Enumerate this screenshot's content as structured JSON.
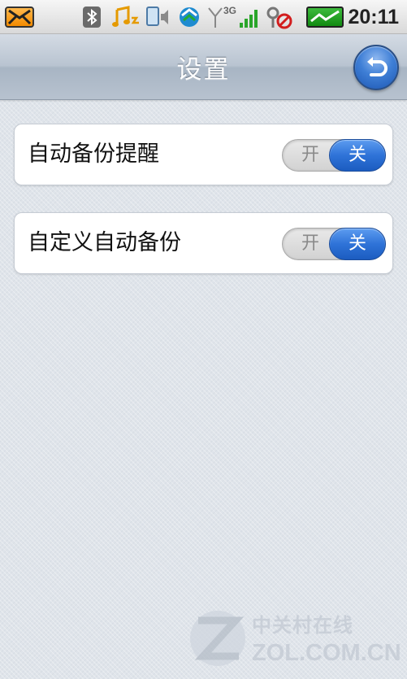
{
  "status_bar": {
    "time": "20:11",
    "signal_network_label": "3G",
    "icons": [
      "mail-icon",
      "bluetooth-icon",
      "music-icon",
      "volume-icon",
      "sync-icon",
      "signal-icon",
      "alarm-icon",
      "battery-icon"
    ]
  },
  "header": {
    "title": "设置",
    "back_icon": "back-arrow-icon"
  },
  "settings": [
    {
      "label": "自动备份提醒",
      "on_label": "开",
      "off_label": "关",
      "state": "off"
    },
    {
      "label": "自定义自动备份",
      "on_label": "开",
      "off_label": "关",
      "state": "off"
    }
  ],
  "colors": {
    "toggle_active": "#2f73d8",
    "title_bar": "#b9c4d1",
    "background": "#dfe4ea"
  },
  "watermark": {
    "name_cn": "中关村在线",
    "domain": "ZOL.COM.CN"
  }
}
